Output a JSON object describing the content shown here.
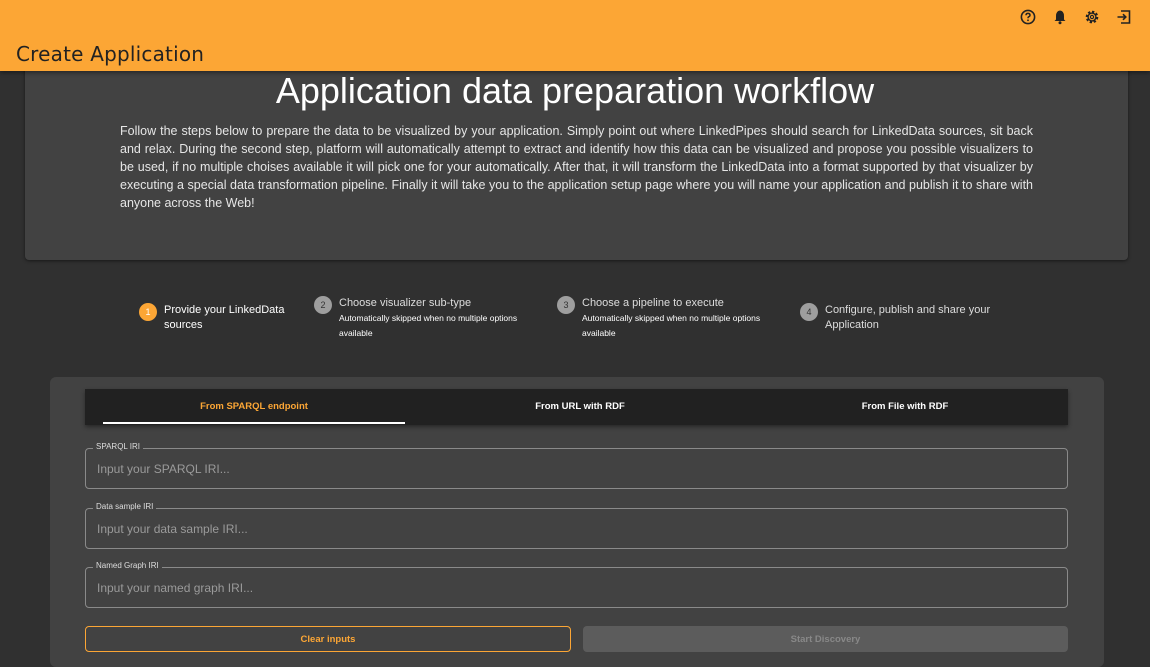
{
  "appbar": {
    "title": "Create Application",
    "icons": [
      "help-circle-icon",
      "bell-icon",
      "gear-icon",
      "logout-icon"
    ]
  },
  "header": {
    "title": "Application data preparation workflow",
    "description": "Follow the steps below to prepare the data to be visualized by your application. Simply point out where LinkedPipes should search for LinkedData sources, sit back and relax. During the second step, platform will automatically attempt to extract and identify how this data can be visualized and propose you possible visualizers to be used, if no multiple choises available it will pick one for your automatically. After that, it will transform the LinkedData into a format supported by that visualizer by executing a special data transformation pipeline. Finally it will take you to the application setup page where you will name your application and publish it to share with anyone across the Web!"
  },
  "steps": [
    {
      "number": "1",
      "label": "Provide your LinkedData sources",
      "sub": "",
      "active": true
    },
    {
      "number": "2",
      "label": "Choose visualizer sub-type",
      "sub": "Automatically skipped when no multiple options available",
      "active": false
    },
    {
      "number": "3",
      "label": "Choose a pipeline to execute",
      "sub": "Automatically skipped when no multiple options available",
      "active": false
    },
    {
      "number": "4",
      "label": "Configure, publish and share your Application",
      "sub": "",
      "active": false
    }
  ],
  "tabs": [
    {
      "label": "From SPARQL endpoint",
      "active": true
    },
    {
      "label": "From URL with RDF",
      "active": false
    },
    {
      "label": "From File with RDF",
      "active": false
    }
  ],
  "fields": {
    "sparql": {
      "label": "SPARQL IRI",
      "placeholder": "Input your SPARQL IRI...",
      "value": ""
    },
    "sample": {
      "label": "Data sample IRI",
      "placeholder": "Input your data sample IRI...",
      "value": ""
    },
    "graph": {
      "label": "Named Graph IRI",
      "placeholder": "Input your named graph IRI...",
      "value": ""
    }
  },
  "buttons": {
    "clear": "Clear inputs",
    "start": "Start Discovery"
  },
  "colors": {
    "accent": "#fca635",
    "background": "#303030",
    "surface": "#424242",
    "tabbar": "#212121"
  }
}
